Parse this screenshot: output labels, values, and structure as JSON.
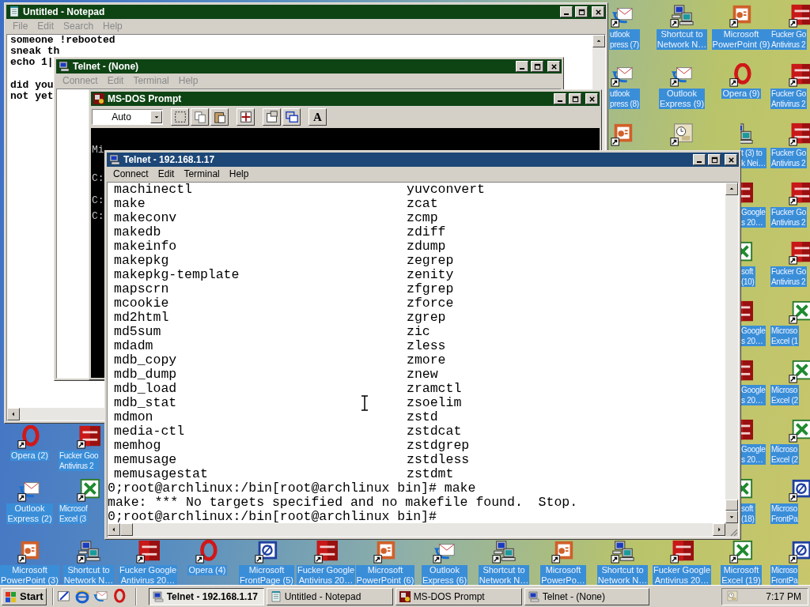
{
  "desktop_icons": [
    {
      "kind": "outlook",
      "label_lines": [
        "utlook",
        "press (7)"
      ]
    },
    {
      "kind": "network",
      "label_lines": [
        "Shortcut to",
        "Network N…"
      ]
    },
    {
      "kind": "powerpoint",
      "label_lines": [
        "Microsoft",
        "PowerPoint (9)"
      ]
    },
    {
      "kind": "fg",
      "label_lines": [
        "Fucker Go",
        "Antivirus 2"
      ]
    },
    {
      "kind": "outlook",
      "label_lines": [
        "utlook",
        "press (8)"
      ]
    },
    {
      "kind": "outlook",
      "label_lines": [
        "Outlook",
        "Express (9)"
      ]
    },
    {
      "kind": "opera",
      "label_lines": [
        "Opera (9)"
      ]
    },
    {
      "kind": "fg",
      "label_lines": [
        "Fucker Go",
        "Antivirus 2"
      ]
    },
    {
      "kind": "powerpoint"
    },
    {
      "kind": "scheduler"
    },
    {
      "kind": "network",
      "label_lines": [
        "t (3) to",
        "k Nei…"
      ]
    },
    {
      "kind": "fg",
      "label_lines": [
        "Fucker Go",
        "Antivirus 2"
      ]
    },
    {
      "kind": "fg",
      "label_lines": [
        "Google",
        "s 20…"
      ]
    },
    {
      "kind": "fg",
      "label_lines": [
        "Fucker Go",
        "Antivirus 2"
      ]
    },
    {
      "kind": "excel",
      "label_lines": [
        "soft",
        "(10)"
      ]
    },
    {
      "kind": "fg",
      "label_lines": [
        "Fucker Go",
        "Antivirus 2"
      ]
    },
    {
      "kind": "fg",
      "label_lines": [
        "Google",
        "s 20…"
      ]
    },
    {
      "kind": "excel",
      "label_lines": [
        "Microso",
        "Excel (1"
      ]
    },
    {
      "kind": "fg",
      "label_lines": [
        "Google",
        "s 20…"
      ]
    },
    {
      "kind": "excel",
      "label_lines": [
        "Microso",
        "Excel (2"
      ]
    },
    {
      "kind": "fg",
      "label_lines": [
        "Google",
        "s 20…"
      ]
    },
    {
      "kind": "excel",
      "label_lines": [
        "Microso",
        "Excel (2"
      ]
    },
    {
      "kind": "excel",
      "label_lines": [
        "soft",
        "(18)"
      ]
    },
    {
      "kind": "frontpage",
      "label_lines": [
        "Microso",
        "FrontPa"
      ]
    },
    {
      "kind": "opera",
      "label_lines": [
        "Opera (2)"
      ]
    },
    {
      "kind": "fg",
      "label_lines": [
        "Fucker Goo",
        "Antivirus 2"
      ]
    },
    {
      "kind": "outlook",
      "label_lines": [
        "Outlook",
        "Express (2)"
      ]
    },
    {
      "kind": "excel",
      "label_lines": [
        "Microsof",
        "Excel (3"
      ]
    },
    {
      "kind": "powerpoint",
      "label_lines": [
        "Microsoft",
        "PowerPoint (3)"
      ]
    },
    {
      "kind": "network",
      "label_lines": [
        "Shortcut to",
        "Network N…"
      ]
    },
    {
      "kind": "fg",
      "label_lines": [
        "Fucker Google",
        "Antivirus 20…"
      ]
    },
    {
      "kind": "opera",
      "label_lines": [
        "Opera (4)"
      ]
    },
    {
      "kind": "frontpage",
      "label_lines": [
        "Microsoft",
        "FrontPage (5)"
      ]
    },
    {
      "kind": "fg",
      "label_lines": [
        "Fucker Google",
        "Antivirus 20…"
      ]
    },
    {
      "kind": "powerpoint",
      "label_lines": [
        "Microsoft",
        "PowerPoint (6)"
      ]
    },
    {
      "kind": "outlook",
      "label_lines": [
        "Outlook",
        "Express (6)"
      ]
    },
    {
      "kind": "network",
      "label_lines": [
        "Shortcut to",
        "Network N…"
      ]
    },
    {
      "kind": "powerpoint",
      "label_lines": [
        "Microsoft",
        "PowerPo…"
      ]
    },
    {
      "kind": "network",
      "label_lines": [
        "Shortcut to",
        "Network N…"
      ]
    },
    {
      "kind": "fg",
      "label_lines": [
        "Fucker Google",
        "Antivirus 20…"
      ]
    },
    {
      "kind": "excel",
      "label_lines": [
        "Microsoft",
        "Excel (19)"
      ]
    },
    {
      "kind": "frontpage",
      "label_lines": [
        "Microso",
        "FrontPa"
      ]
    }
  ],
  "windows": [
    {
      "kind": "notepad",
      "title": "Untitled - Notepad",
      "active": false,
      "menu": [
        {
          "label": "File",
          "disabled": true
        },
        {
          "label": "Edit",
          "disabled": true
        },
        {
          "label": "Search",
          "disabled": true
        },
        {
          "label": "Help",
          "disabled": true
        }
      ],
      "paragraphs": [
        [
          "someone !rebooted",
          "sneak th",
          "echo 1|"
        ],
        [
          "did you",
          "not yet"
        ]
      ]
    },
    {
      "kind": "telnet",
      "title": "Telnet - (None)",
      "active": false,
      "menu": [
        {
          "label": "Connect",
          "disabled": true
        },
        {
          "label": "Edit",
          "disabled": true
        },
        {
          "label": "Terminal",
          "disabled": true
        },
        {
          "label": "Help",
          "disabled": true
        }
      ]
    },
    {
      "kind": "dos",
      "title": "MS-DOS Prompt",
      "active": false,
      "font_size": "Auto",
      "font_button": "A",
      "console_lines": [
        "Mi",
        "C:",
        "C:",
        "C:"
      ]
    },
    {
      "kind": "telnet",
      "title": "Telnet - 192.168.1.17",
      "active": true,
      "menu": [
        {
          "label": "Connect",
          "disabled": false
        },
        {
          "label": "Edit",
          "disabled": false
        },
        {
          "label": "Terminal",
          "disabled": false
        },
        {
          "label": "Help",
          "disabled": false
        }
      ],
      "terminal": {
        "listing": [
          {
            "col_1": "machinectl",
            "col_2": "yuvconvert"
          },
          {
            "col_1": "make",
            "col_2": "zcat"
          },
          {
            "col_1": "makeconv",
            "col_2": "zcmp"
          },
          {
            "col_1": "makedb",
            "col_2": "zdiff"
          },
          {
            "col_1": "makeinfo",
            "col_2": "zdump"
          },
          {
            "col_1": "makepkg",
            "col_2": "zegrep"
          },
          {
            "col_1": "makepkg-template",
            "col_2": "zenity"
          },
          {
            "col_1": "mapscrn",
            "col_2": "zfgrep"
          },
          {
            "col_1": "mcookie",
            "col_2": "zforce"
          },
          {
            "col_1": "md2html",
            "col_2": "zgrep"
          },
          {
            "col_1": "md5sum",
            "col_2": "zic"
          },
          {
            "col_1": "mdadm",
            "col_2": "zless"
          },
          {
            "col_1": "mdb_copy",
            "col_2": "zmore"
          },
          {
            "col_1": "mdb_dump",
            "col_2": "znew"
          },
          {
            "col_1": "mdb_load",
            "col_2": "zramctl"
          },
          {
            "col_1": "mdb_stat",
            "col_2": "zsoelim"
          },
          {
            "col_1": "mdmon",
            "col_2": "zstd"
          },
          {
            "col_1": "media-ctl",
            "col_2": "zstdcat"
          },
          {
            "col_1": "memhog",
            "col_2": "zstdgrep"
          },
          {
            "col_1": "memusage",
            "col_2": "zstdless"
          },
          {
            "col_1": "memusagestat",
            "col_2": "zstdmt"
          }
        ],
        "output": [
          "0;root@archlinux:/bin[root@archlinux bin]# make",
          "make: *** No targets specified and no makefile found.  Stop.",
          "0;root@archlinux:/bin[root@archlinux bin]#"
        ]
      }
    }
  ],
  "taskbar": {
    "start": "Start",
    "quick_launch": [
      {
        "kind": "desktop"
      },
      {
        "kind": "browser"
      },
      {
        "kind": "outlook"
      },
      {
        "kind": "opera"
      }
    ],
    "tasks": [
      {
        "kind": "telnet",
        "label": "Telnet - 192.168.1.17",
        "selected": true
      },
      {
        "kind": "notepad",
        "label": "Untitled - Notepad",
        "selected": false
      },
      {
        "kind": "dos",
        "label": "MS-DOS Prompt",
        "selected": false
      },
      {
        "kind": "telnet",
        "label": "Telnet - (None)",
        "selected": false
      }
    ],
    "clock": "7:17 PM"
  }
}
